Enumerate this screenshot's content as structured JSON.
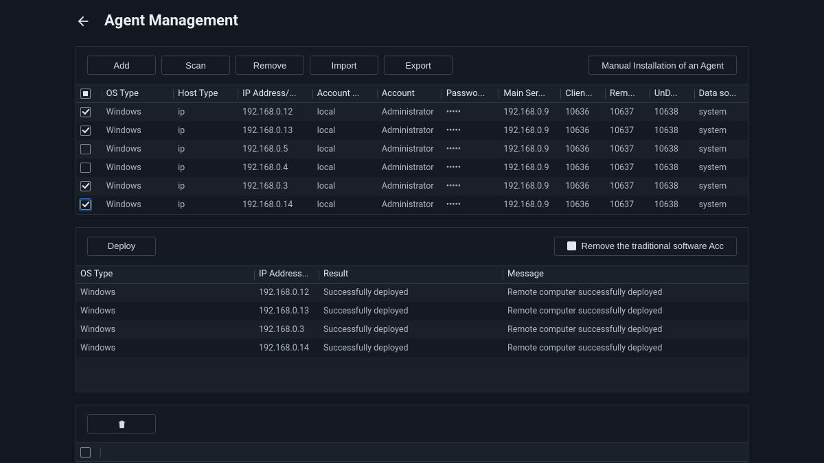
{
  "header": {
    "title": "Agent Management"
  },
  "toolbar": {
    "add": "Add",
    "scan": "Scan",
    "remove": "Remove",
    "import": "Import",
    "export": "Export",
    "manual": "Manual Installation of an Agent"
  },
  "agents": {
    "columns": {
      "os": "OS Type",
      "host": "Host Type",
      "ip": "IP Address/...",
      "acct_type": "Account ...",
      "account": "Account",
      "password": "Passwo...",
      "main": "Main Ser...",
      "client": "Clien...",
      "rem": "Rem...",
      "und": "UnD...",
      "data": "Data so..."
    },
    "rows": [
      {
        "checked": true,
        "os": "Windows",
        "host": "ip",
        "ip": "192.168.0.12",
        "acct_type": "local",
        "account": "Administrator",
        "password": "•••••",
        "main": "192.168.0.9",
        "client": "10636",
        "rem": "10637",
        "und": "10638",
        "data": "system"
      },
      {
        "checked": true,
        "os": "Windows",
        "host": "ip",
        "ip": "192.168.0.13",
        "acct_type": "local",
        "account": "Administrator",
        "password": "•••••",
        "main": "192.168.0.9",
        "client": "10636",
        "rem": "10637",
        "und": "10638",
        "data": "system"
      },
      {
        "checked": false,
        "os": "Windows",
        "host": "ip",
        "ip": "192.168.0.5",
        "acct_type": "local",
        "account": "Administrator",
        "password": "•••••",
        "main": "192.168.0.9",
        "client": "10636",
        "rem": "10637",
        "und": "10638",
        "data": "system"
      },
      {
        "checked": false,
        "os": "Windows",
        "host": "ip",
        "ip": "192.168.0.4",
        "acct_type": "local",
        "account": "Administrator",
        "password": "•••••",
        "main": "192.168.0.9",
        "client": "10636",
        "rem": "10637",
        "und": "10638",
        "data": "system"
      },
      {
        "checked": true,
        "os": "Windows",
        "host": "ip",
        "ip": "192.168.0.3",
        "acct_type": "local",
        "account": "Administrator",
        "password": "•••••",
        "main": "192.168.0.9",
        "client": "10636",
        "rem": "10637",
        "und": "10638",
        "data": "system"
      },
      {
        "checked": true,
        "hl": true,
        "os": "Windows",
        "host": "ip",
        "ip": "192.168.0.14",
        "acct_type": "local",
        "account": "Administrator",
        "password": "•••••",
        "main": "192.168.0.9",
        "client": "10636",
        "rem": "10637",
        "und": "10638",
        "data": "system"
      }
    ]
  },
  "deploy": {
    "button": "Deploy",
    "remove_acc": "Remove the traditional software Acc",
    "columns": {
      "os": "OS Type",
      "ip": "IP Address...",
      "result": "Result",
      "message": "Message"
    },
    "rows": [
      {
        "os": "Windows",
        "ip": "192.168.0.12",
        "result": "Successfully deployed",
        "message": "Remote computer successfully deployed"
      },
      {
        "os": "Windows",
        "ip": "192.168.0.13",
        "result": "Successfully deployed",
        "message": "Remote computer successfully deployed"
      },
      {
        "os": "Windows",
        "ip": "192.168.0.3",
        "result": "Successfully deployed",
        "message": "Remote computer successfully deployed"
      },
      {
        "os": "Windows",
        "ip": "192.168.0.14",
        "result": "Successfully deployed",
        "message": "Remote computer successfully deployed"
      }
    ]
  }
}
